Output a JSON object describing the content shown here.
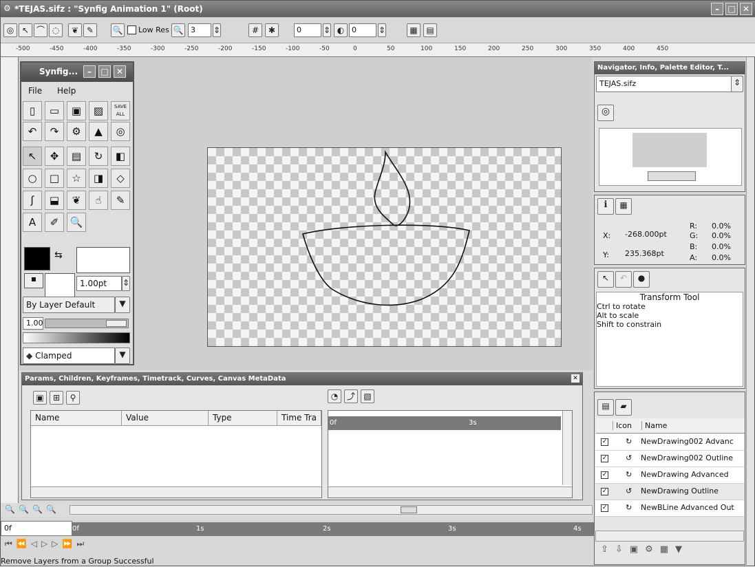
{
  "window": {
    "title": "*TEJAS.sifz : \"Synfig Animation 1\" (Root)"
  },
  "toolbar": {
    "low_res_label": "Low Res",
    "value_box_1": "3",
    "value_box_2": "0",
    "value_box_3": "0"
  },
  "ruler": {
    "labels": [
      "-500",
      "-450",
      "-400",
      "-350",
      "-300",
      "-250",
      "-200",
      "-150",
      "-100",
      "-50",
      "0",
      "50",
      "100",
      "150",
      "200",
      "250",
      "300",
      "350",
      "400",
      "450"
    ]
  },
  "toolbox": {
    "title": "Synfig...",
    "menu": [
      "File",
      "Help"
    ],
    "save_all": "SAVE ALL",
    "width": "1.00pt",
    "blend": "By Layer Default",
    "amount": "1.00",
    "interp": "Clamped"
  },
  "params_panel": {
    "title": "Params, Children, Keyframes, Timetrack, Curves, Canvas MetaData",
    "columns": [
      "Name",
      "Value",
      "Type",
      "Time Tra"
    ],
    "track_labels": [
      "0f",
      "3s"
    ]
  },
  "timebar": {
    "current": "0f",
    "labels": [
      "0f",
      "1s",
      "2s",
      "3s",
      "4s"
    ]
  },
  "status": "Remove Layers from a Group Successful",
  "navigator": {
    "title": "Navigator, Info, Palette Editor, T...",
    "file": "TEJAS.sifz"
  },
  "info": {
    "x_label": "X:",
    "x_value": "-268.000pt",
    "y_label": "Y:",
    "y_value": "235.368pt",
    "r_label": "R:",
    "r_value": "0.0%",
    "g_label": "G:",
    "g_value": "0.0%",
    "b_label": "B:",
    "b_value": "0.0%",
    "a_label": "A:",
    "a_value": "0.0%"
  },
  "tool_options": {
    "name": "Transform Tool",
    "lines": [
      "Ctrl to rotate",
      "Alt to scale",
      "Shift to constrain"
    ]
  },
  "layers": {
    "columns": [
      "Icon",
      "Name"
    ],
    "rows": [
      "NewDrawing002 Advanc",
      "NewDrawing002 Outline",
      "NewDrawing Advanced",
      "NewDrawing Outline",
      "NewBLine Advanced Out"
    ]
  }
}
